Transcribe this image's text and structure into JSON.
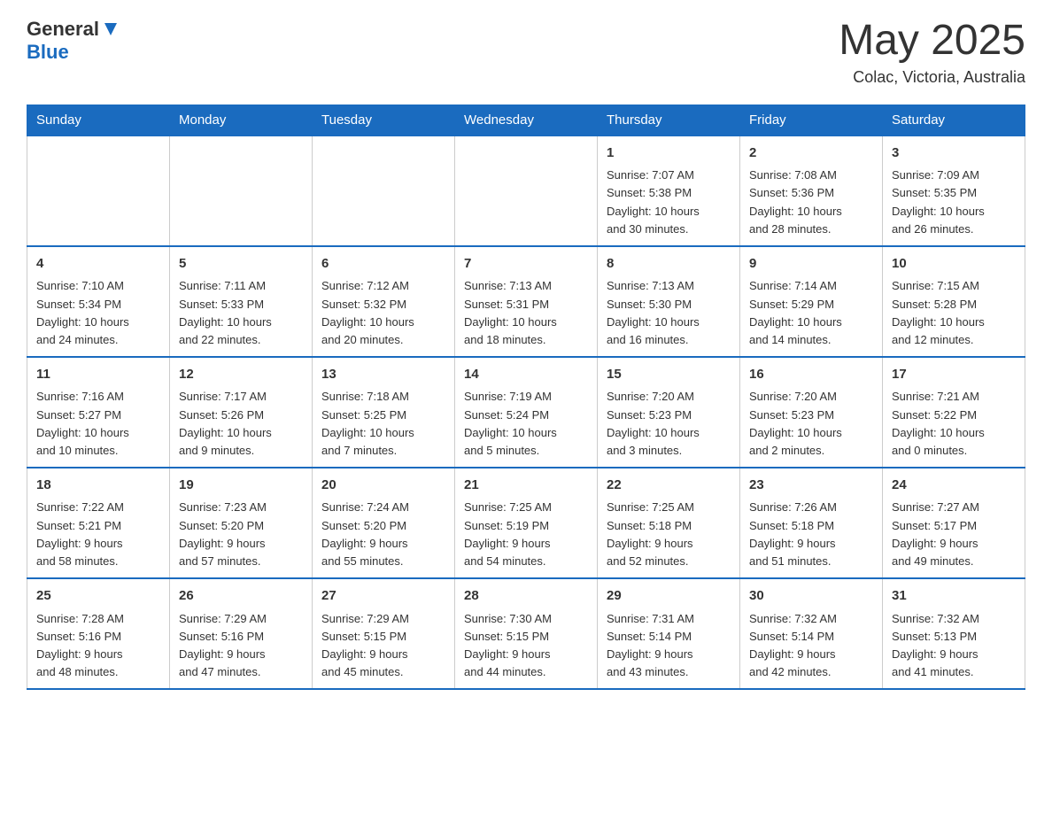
{
  "header": {
    "logo_general": "General",
    "logo_blue": "Blue",
    "month_year": "May 2025",
    "location": "Colac, Victoria, Australia"
  },
  "days_of_week": [
    "Sunday",
    "Monday",
    "Tuesday",
    "Wednesday",
    "Thursday",
    "Friday",
    "Saturday"
  ],
  "weeks": [
    {
      "cells": [
        {
          "day": "",
          "info": ""
        },
        {
          "day": "",
          "info": ""
        },
        {
          "day": "",
          "info": ""
        },
        {
          "day": "",
          "info": ""
        },
        {
          "day": "1",
          "info": "Sunrise: 7:07 AM\nSunset: 5:38 PM\nDaylight: 10 hours\nand 30 minutes."
        },
        {
          "day": "2",
          "info": "Sunrise: 7:08 AM\nSunset: 5:36 PM\nDaylight: 10 hours\nand 28 minutes."
        },
        {
          "day": "3",
          "info": "Sunrise: 7:09 AM\nSunset: 5:35 PM\nDaylight: 10 hours\nand 26 minutes."
        }
      ]
    },
    {
      "cells": [
        {
          "day": "4",
          "info": "Sunrise: 7:10 AM\nSunset: 5:34 PM\nDaylight: 10 hours\nand 24 minutes."
        },
        {
          "day": "5",
          "info": "Sunrise: 7:11 AM\nSunset: 5:33 PM\nDaylight: 10 hours\nand 22 minutes."
        },
        {
          "day": "6",
          "info": "Sunrise: 7:12 AM\nSunset: 5:32 PM\nDaylight: 10 hours\nand 20 minutes."
        },
        {
          "day": "7",
          "info": "Sunrise: 7:13 AM\nSunset: 5:31 PM\nDaylight: 10 hours\nand 18 minutes."
        },
        {
          "day": "8",
          "info": "Sunrise: 7:13 AM\nSunset: 5:30 PM\nDaylight: 10 hours\nand 16 minutes."
        },
        {
          "day": "9",
          "info": "Sunrise: 7:14 AM\nSunset: 5:29 PM\nDaylight: 10 hours\nand 14 minutes."
        },
        {
          "day": "10",
          "info": "Sunrise: 7:15 AM\nSunset: 5:28 PM\nDaylight: 10 hours\nand 12 minutes."
        }
      ]
    },
    {
      "cells": [
        {
          "day": "11",
          "info": "Sunrise: 7:16 AM\nSunset: 5:27 PM\nDaylight: 10 hours\nand 10 minutes."
        },
        {
          "day": "12",
          "info": "Sunrise: 7:17 AM\nSunset: 5:26 PM\nDaylight: 10 hours\nand 9 minutes."
        },
        {
          "day": "13",
          "info": "Sunrise: 7:18 AM\nSunset: 5:25 PM\nDaylight: 10 hours\nand 7 minutes."
        },
        {
          "day": "14",
          "info": "Sunrise: 7:19 AM\nSunset: 5:24 PM\nDaylight: 10 hours\nand 5 minutes."
        },
        {
          "day": "15",
          "info": "Sunrise: 7:20 AM\nSunset: 5:23 PM\nDaylight: 10 hours\nand 3 minutes."
        },
        {
          "day": "16",
          "info": "Sunrise: 7:20 AM\nSunset: 5:23 PM\nDaylight: 10 hours\nand 2 minutes."
        },
        {
          "day": "17",
          "info": "Sunrise: 7:21 AM\nSunset: 5:22 PM\nDaylight: 10 hours\nand 0 minutes."
        }
      ]
    },
    {
      "cells": [
        {
          "day": "18",
          "info": "Sunrise: 7:22 AM\nSunset: 5:21 PM\nDaylight: 9 hours\nand 58 minutes."
        },
        {
          "day": "19",
          "info": "Sunrise: 7:23 AM\nSunset: 5:20 PM\nDaylight: 9 hours\nand 57 minutes."
        },
        {
          "day": "20",
          "info": "Sunrise: 7:24 AM\nSunset: 5:20 PM\nDaylight: 9 hours\nand 55 minutes."
        },
        {
          "day": "21",
          "info": "Sunrise: 7:25 AM\nSunset: 5:19 PM\nDaylight: 9 hours\nand 54 minutes."
        },
        {
          "day": "22",
          "info": "Sunrise: 7:25 AM\nSunset: 5:18 PM\nDaylight: 9 hours\nand 52 minutes."
        },
        {
          "day": "23",
          "info": "Sunrise: 7:26 AM\nSunset: 5:18 PM\nDaylight: 9 hours\nand 51 minutes."
        },
        {
          "day": "24",
          "info": "Sunrise: 7:27 AM\nSunset: 5:17 PM\nDaylight: 9 hours\nand 49 minutes."
        }
      ]
    },
    {
      "cells": [
        {
          "day": "25",
          "info": "Sunrise: 7:28 AM\nSunset: 5:16 PM\nDaylight: 9 hours\nand 48 minutes."
        },
        {
          "day": "26",
          "info": "Sunrise: 7:29 AM\nSunset: 5:16 PM\nDaylight: 9 hours\nand 47 minutes."
        },
        {
          "day": "27",
          "info": "Sunrise: 7:29 AM\nSunset: 5:15 PM\nDaylight: 9 hours\nand 45 minutes."
        },
        {
          "day": "28",
          "info": "Sunrise: 7:30 AM\nSunset: 5:15 PM\nDaylight: 9 hours\nand 44 minutes."
        },
        {
          "day": "29",
          "info": "Sunrise: 7:31 AM\nSunset: 5:14 PM\nDaylight: 9 hours\nand 43 minutes."
        },
        {
          "day": "30",
          "info": "Sunrise: 7:32 AM\nSunset: 5:14 PM\nDaylight: 9 hours\nand 42 minutes."
        },
        {
          "day": "31",
          "info": "Sunrise: 7:32 AM\nSunset: 5:13 PM\nDaylight: 9 hours\nand 41 minutes."
        }
      ]
    }
  ]
}
